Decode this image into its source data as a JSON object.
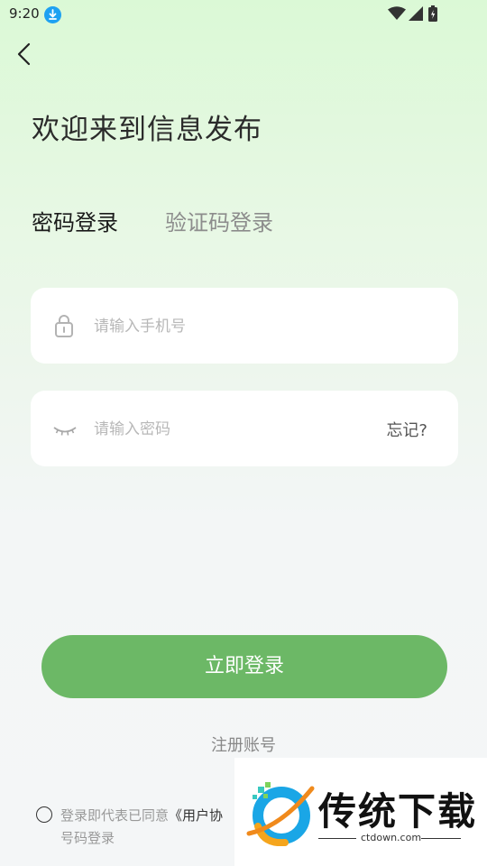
{
  "status_bar": {
    "time": "9:20"
  },
  "header": {
    "welcome_title": "欢迎来到信息发布"
  },
  "tabs": [
    {
      "label": "密码登录",
      "active": true
    },
    {
      "label": "验证码登录",
      "active": false
    }
  ],
  "form": {
    "phone": {
      "placeholder": "请输入手机号",
      "value": ""
    },
    "password": {
      "placeholder": "请输入密码",
      "value": "",
      "forgot_label": "忘记?"
    }
  },
  "actions": {
    "login_label": "立即登录",
    "register_label": "注册账号"
  },
  "agreement": {
    "prefix": "登录即代表已同意",
    "link_partial": "《用户协",
    "line2": "号码登录",
    "checked": false
  },
  "watermark": {
    "title": "传统下载",
    "url": "ctdown.com"
  },
  "colors": {
    "accent": "#6cb866",
    "download_badge": "#1ea1f2",
    "background_top": "#dbf9d6",
    "background_bottom": "#f4f6f7"
  }
}
